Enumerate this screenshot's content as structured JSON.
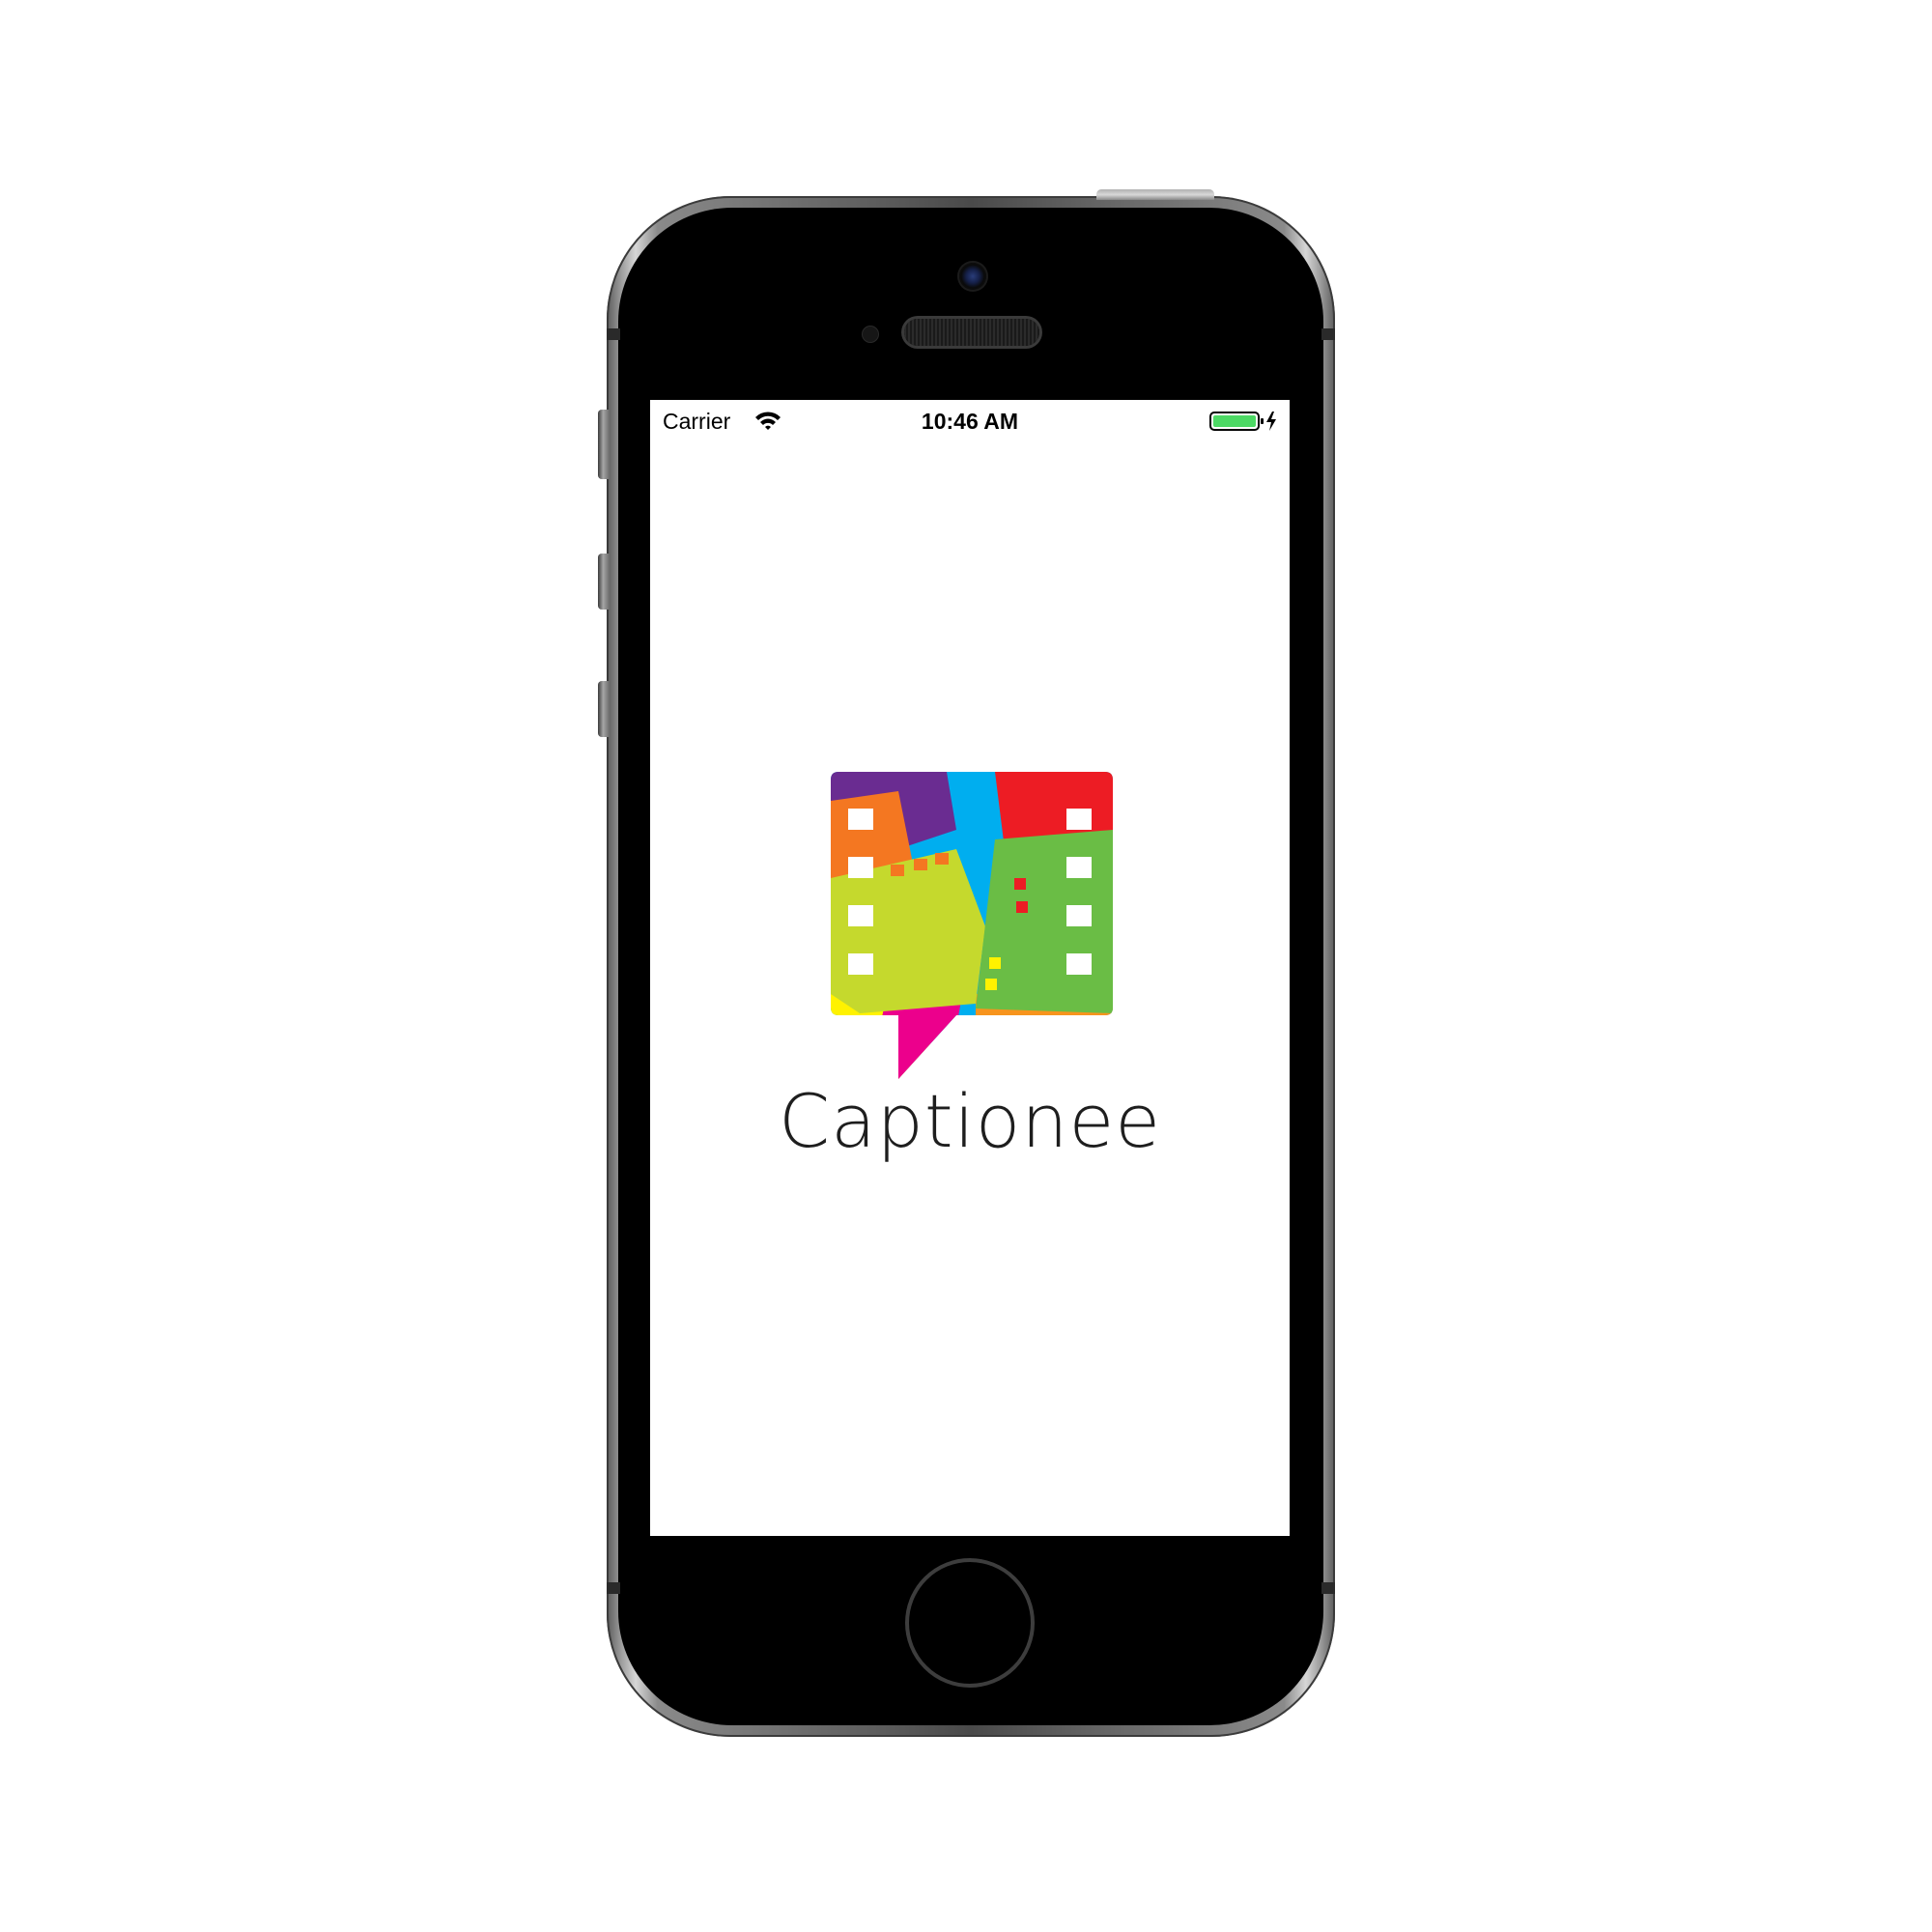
{
  "status_bar": {
    "carrier": "Carrier",
    "time": "10:46 AM",
    "battery_color": "#4cd964",
    "signal_icon": "wifi-icon",
    "battery_icon": "battery-charging-icon"
  },
  "splash": {
    "app_name": "Captionee",
    "logo": "captionee-logo",
    "logo_colors": [
      "#6a2c91",
      "#f47721",
      "#00aeef",
      "#ed1c24",
      "#c5d92d",
      "#6abd45",
      "#ec008c",
      "#fff200",
      "#0072bc"
    ]
  }
}
